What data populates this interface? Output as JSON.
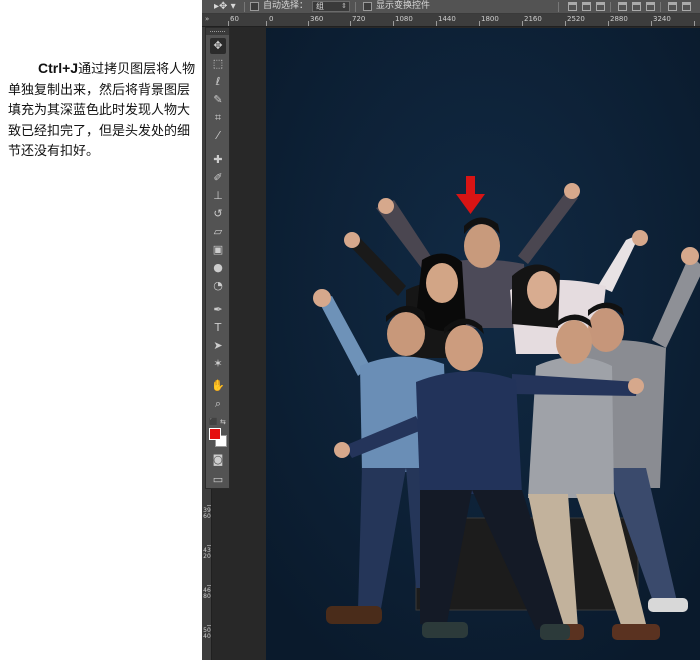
{
  "tutorial": {
    "keyword": "Ctrl+J",
    "text": "通过拷贝图层将人物单独复制出来，然后将背景图层填充为其深蓝色此时发现人物大致已经扣完了，但是头发处的细节还没有扣好。"
  },
  "options_bar": {
    "tool_icon": "move-tool-icon",
    "auto_select_label": "自动选择：",
    "auto_select_value": "组",
    "show_transform_label": "显示变换控件"
  },
  "ruler": {
    "h_ticks": [
      "0",
      "360",
      "720",
      "1080",
      "1440",
      "1800",
      "2160",
      "2520",
      "2880",
      "3240"
    ],
    "v_ticks": [
      "3960",
      "4320",
      "4680",
      "5040"
    ],
    "first_partial": "60"
  },
  "toolbox": {
    "tools": [
      "move-tool-icon",
      "marquee-tool-icon",
      "lasso-tool-icon",
      "quick-select-tool-icon",
      "crop-tool-icon",
      "eyedropper-tool-icon",
      "healing-tool-icon",
      "brush-tool-icon",
      "stamp-tool-icon",
      "history-brush-icon",
      "eraser-tool-icon",
      "gradient-tool-icon",
      "blur-tool-icon",
      "dodge-tool-icon",
      "pen-tool-icon",
      "type-tool-icon",
      "path-select-tool-icon",
      "shape-tool-icon",
      "hand-tool-icon",
      "zoom-tool-icon"
    ],
    "foreground_color": "#e50f0f",
    "background_color": "#ffffff"
  },
  "canvas": {
    "background_color": "#0d1f34",
    "arrow_color": "#d81414"
  }
}
